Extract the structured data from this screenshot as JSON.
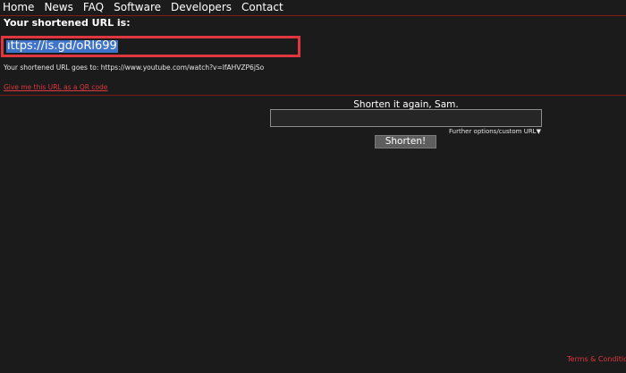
{
  "nav": {
    "items": [
      "Home",
      "News",
      "FAQ",
      "Software",
      "Developers",
      "Contact"
    ]
  },
  "result": {
    "title": "Your shortened URL is:",
    "short_url": "ıttps://is.gd/oRl699",
    "goes_to_label": "Your shortened URL goes to: ",
    "goes_to_url": "https://www.youtube.com/watch?v=lfAHVZP6jSo",
    "qr_link": "Give me this URL as a QR code"
  },
  "shorten_again": {
    "heading": "Shorten it again, Sam.",
    "input_value": "",
    "further_options": "Further options/custom URL▼",
    "button_label": "Shorten!"
  },
  "footer": {
    "terms": "Terms & Conditions"
  },
  "colors": {
    "background": "#1b1b1b",
    "accent_red": "#e0363f",
    "selection_blue": "#3f74c9"
  }
}
